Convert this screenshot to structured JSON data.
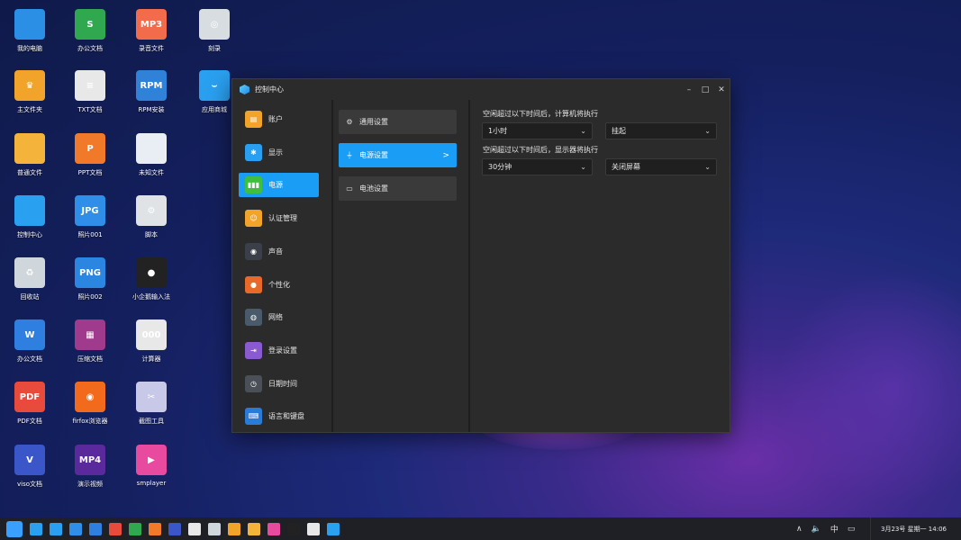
{
  "desktop": {
    "icons": [
      {
        "label": "我的电脑",
        "glyph": "",
        "color": "#2b8fe6"
      },
      {
        "label": "主文件夹",
        "glyph": "♛",
        "color": "#f2a32a"
      },
      {
        "label": "普通文件",
        "glyph": "",
        "color": "#f4b43c"
      },
      {
        "label": "控制中心",
        "glyph": "",
        "color": "#2aa0f0"
      },
      {
        "label": "回收站",
        "glyph": "♻",
        "color": "#cfd6dc"
      },
      {
        "label": "办公文档",
        "glyph": "W",
        "color": "#2f7fe0"
      },
      {
        "label": "PDF文档",
        "glyph": "PDF",
        "color": "#e84b3c"
      },
      {
        "label": "viso文档",
        "glyph": "V",
        "color": "#3a56c8"
      },
      {
        "label": "办公文档",
        "glyph": "S",
        "color": "#2fa84f"
      },
      {
        "label": "TXT文档",
        "glyph": "≡",
        "color": "#e8e8e8"
      },
      {
        "label": "PPT文档",
        "glyph": "P",
        "color": "#f07a2a"
      },
      {
        "label": "照片001",
        "glyph": "JPG",
        "color": "#2f8fe8"
      },
      {
        "label": "照片002",
        "glyph": "PNG",
        "color": "#2a86e0"
      },
      {
        "label": "压缩文档",
        "glyph": "▦",
        "color": "#a03a8c"
      },
      {
        "label": "firfox浏览器",
        "glyph": "◉",
        "color": "#f26b1d"
      },
      {
        "label": "演示视频",
        "glyph": "MP4",
        "color": "#5a2a9c"
      },
      {
        "label": "录音文件",
        "glyph": "MP3",
        "color": "#f26b4a"
      },
      {
        "label": "RPM安装",
        "glyph": "RPM",
        "color": "#2f82d8"
      },
      {
        "label": "未知文件",
        "glyph": "",
        "color": "#e8eef4"
      },
      {
        "label": "脚本",
        "glyph": "⚙",
        "color": "#dfe3e6"
      },
      {
        "label": "小企鹅输入法",
        "glyph": "●",
        "color": "#222222"
      },
      {
        "label": "计算器",
        "glyph": "000",
        "color": "#e8e8e8"
      },
      {
        "label": "截图工具",
        "glyph": "✂",
        "color": "#c8c8e8"
      },
      {
        "label": "smplayer",
        "glyph": "▶",
        "color": "#e84aa0"
      },
      {
        "label": "刻录",
        "glyph": "◎",
        "color": "#d8dde2"
      },
      {
        "label": "应用商城",
        "glyph": "⌣",
        "color": "#2aa0f0"
      }
    ]
  },
  "window": {
    "title": "控制中心",
    "controls": {
      "minimize": "–",
      "maximize": "□",
      "close": "✕"
    },
    "nav": [
      {
        "label": "账户",
        "icon": "user-icon",
        "color": "#f2a32a",
        "glyph": "▤",
        "active": false
      },
      {
        "label": "显示",
        "icon": "display-icon",
        "color": "#2a9ef0",
        "glyph": "✱",
        "active": false
      },
      {
        "label": "电源",
        "icon": "battery-icon",
        "color": "#3fbf3f",
        "glyph": "▮▮▮",
        "active": true
      },
      {
        "label": "认证管理",
        "icon": "auth-icon",
        "color": "#f2a32a",
        "glyph": "☺",
        "active": false
      },
      {
        "label": "声音",
        "icon": "speaker-icon",
        "color": "#3a3f4a",
        "glyph": "◉",
        "active": false
      },
      {
        "label": "个性化",
        "icon": "palette-icon",
        "color": "#e86a2a",
        "glyph": "●",
        "active": false
      },
      {
        "label": "网络",
        "icon": "globe-icon",
        "color": "#4a5a6a",
        "glyph": "◍",
        "active": false
      },
      {
        "label": "登录设置",
        "icon": "login-icon",
        "color": "#8a5ad0",
        "glyph": "⇥",
        "active": false
      },
      {
        "label": "日期时间",
        "icon": "clock-icon",
        "color": "#4a4f58",
        "glyph": "◷",
        "active": false
      },
      {
        "label": "语言和键盘",
        "icon": "keyboard-icon",
        "color": "#2a7ad8",
        "glyph": "⌨",
        "active": false
      }
    ],
    "subnav": [
      {
        "label": "通用设置",
        "glyph": "⚙",
        "icon": "gear-icon",
        "active": false
      },
      {
        "label": "电源设置",
        "glyph": "⏚",
        "icon": "power-plug-icon",
        "active": true
      },
      {
        "label": "电池设置",
        "glyph": "▭",
        "icon": "battery-small-icon",
        "active": false
      }
    ],
    "subnav_chevron": ">",
    "settings": {
      "computer_label": "空闲超过以下时间后，计算机将执行",
      "computer_time": "1小时",
      "computer_action": "挂起",
      "display_label": "空闲超过以下时间后，显示器将执行",
      "display_time": "30分钟",
      "display_action": "关闭屏幕",
      "arrow": "⌄"
    }
  },
  "taskbar": {
    "tray": {
      "up": "∧",
      "volume": "🔈",
      "ime": "中",
      "monitor": "▭"
    },
    "clock": "3月23号 星期一 14:06"
  }
}
